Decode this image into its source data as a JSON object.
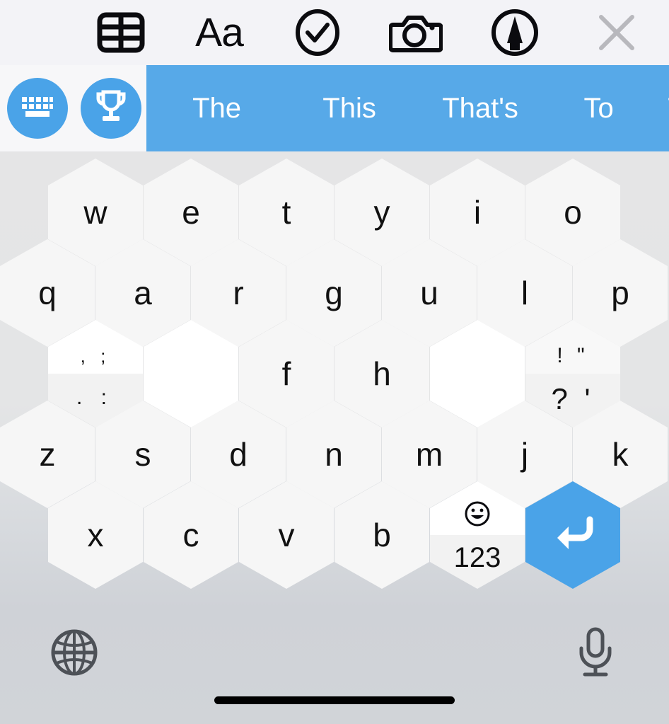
{
  "toolbar": {
    "items": [
      {
        "name": "table-icon",
        "label": "Table"
      },
      {
        "name": "text-format-icon",
        "label": "Aa"
      },
      {
        "name": "checkmark-circle-icon",
        "label": "Checklist"
      },
      {
        "name": "camera-icon",
        "label": "Camera"
      },
      {
        "name": "markup-pen-icon",
        "label": "Markup"
      },
      {
        "name": "close-icon",
        "label": "Close"
      }
    ]
  },
  "suggestion_bar": {
    "keyboard_button_label": "Keyboard",
    "trophy_button_label": "Trophy",
    "suggestions": [
      "The",
      "This",
      "That's",
      "To",
      "T"
    ]
  },
  "keyboard": {
    "rows": [
      {
        "keys": [
          {
            "label": "w",
            "name": "key-w",
            "type": "letter"
          },
          {
            "label": "e",
            "name": "key-e",
            "type": "letter"
          },
          {
            "label": "t",
            "name": "key-t",
            "type": "letter"
          },
          {
            "label": "y",
            "name": "key-y",
            "type": "letter"
          },
          {
            "label": "i",
            "name": "key-i",
            "type": "letter"
          },
          {
            "label": "o",
            "name": "key-o",
            "type": "letter"
          }
        ]
      },
      {
        "keys": [
          {
            "label": "q",
            "name": "key-q",
            "type": "letter"
          },
          {
            "label": "a",
            "name": "key-a",
            "type": "letter"
          },
          {
            "label": "r",
            "name": "key-r",
            "type": "letter"
          },
          {
            "label": "g",
            "name": "key-g",
            "type": "letter"
          },
          {
            "label": "u",
            "name": "key-u",
            "type": "letter"
          },
          {
            "label": "l",
            "name": "key-l",
            "type": "letter"
          },
          {
            "label": "p",
            "name": "key-p",
            "type": "letter"
          }
        ]
      },
      {
        "keys": [
          {
            "label": ", ;",
            "label2": ". :",
            "name": "key-punctuation-left",
            "type": "split"
          },
          {
            "label": "",
            "name": "key-space-left",
            "type": "blank"
          },
          {
            "label": "f",
            "name": "key-f",
            "type": "letter"
          },
          {
            "label": "h",
            "name": "key-h",
            "type": "letter"
          },
          {
            "label": "",
            "name": "key-space-right",
            "type": "blank"
          },
          {
            "label": "! \"",
            "label2": "? '",
            "name": "key-punctuation-right",
            "type": "split"
          }
        ]
      },
      {
        "keys": [
          {
            "label": "z",
            "name": "key-z",
            "type": "letter"
          },
          {
            "label": "s",
            "name": "key-s",
            "type": "letter"
          },
          {
            "label": "d",
            "name": "key-d",
            "type": "letter"
          },
          {
            "label": "n",
            "name": "key-n",
            "type": "letter"
          },
          {
            "label": "m",
            "name": "key-m",
            "type": "letter"
          },
          {
            "label": "j",
            "name": "key-j",
            "type": "letter"
          },
          {
            "label": "k",
            "name": "key-k",
            "type": "letter"
          }
        ]
      },
      {
        "keys": [
          {
            "label": "x",
            "name": "key-x",
            "type": "letter"
          },
          {
            "label": "c",
            "name": "key-c",
            "type": "letter"
          },
          {
            "label": "v",
            "name": "key-v",
            "type": "letter"
          },
          {
            "label": "b",
            "name": "key-b",
            "type": "letter"
          },
          {
            "label": "123",
            "name": "key-numeric-emoji",
            "type": "numeric"
          },
          {
            "label": "return",
            "name": "key-return",
            "type": "return"
          }
        ]
      }
    ],
    "punctuation_left_top": ", ;",
    "punctuation_left_bottom": ". :",
    "punctuation_right_top": "! \"",
    "punctuation_right_bottom": "? '",
    "numeric_label": "123",
    "emoji_label": "emoji"
  },
  "bottom_bar": {
    "globe_label": "Next keyboard",
    "mic_label": "Dictation"
  },
  "colors": {
    "accent_blue": "#4aa3e8",
    "suggestion_blue": "#57a9e8",
    "toolbar_bg": "#f3f3f7",
    "key_bg": "#f6f6f6",
    "key_blank_bg": "#ffffff",
    "icon_dark": "#111111",
    "icon_gray": "#4d5157",
    "close_gray": "#b8b8bd"
  }
}
